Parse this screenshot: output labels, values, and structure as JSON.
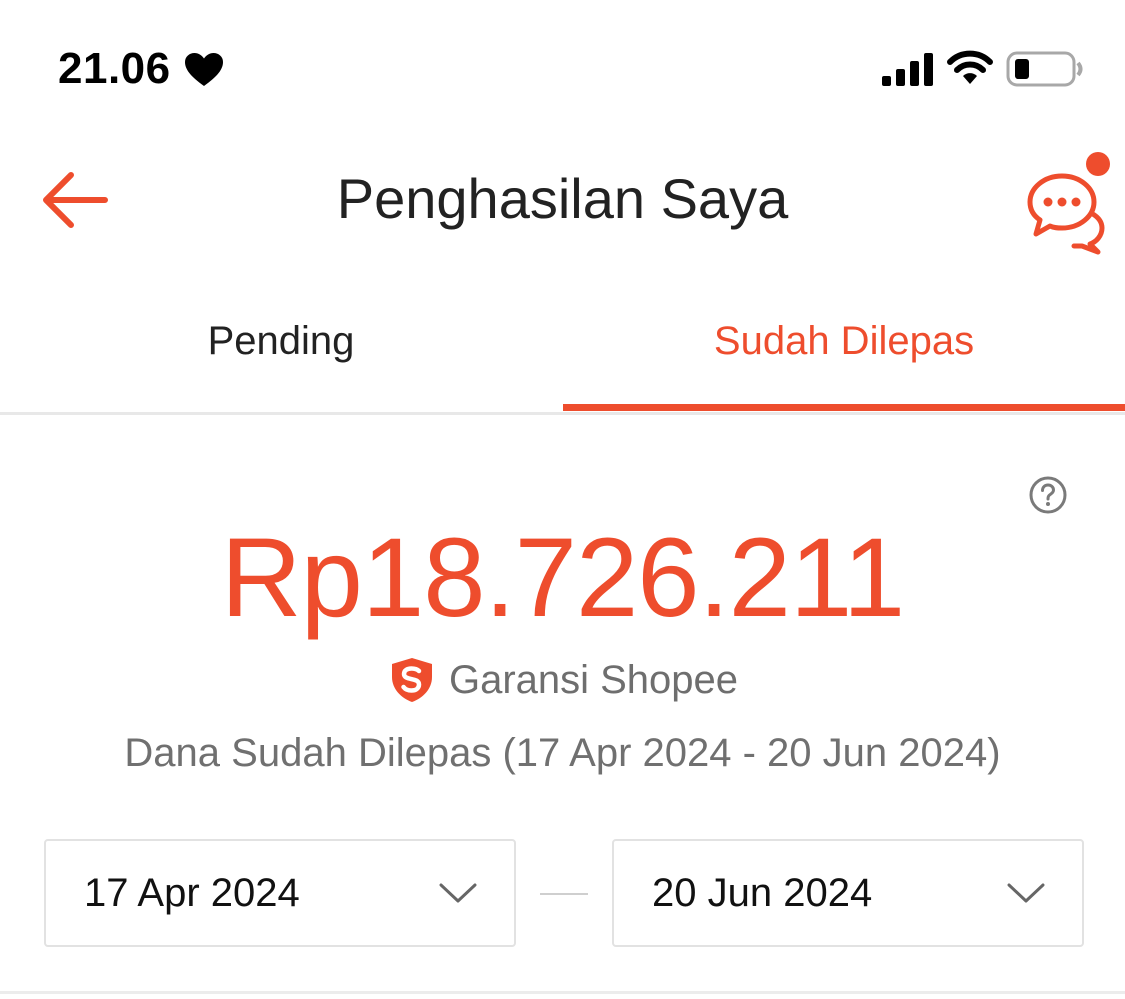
{
  "status_bar": {
    "time": "21.06",
    "icons": [
      "heart-icon",
      "signal-icon",
      "wifi-icon",
      "battery-icon"
    ]
  },
  "header": {
    "title": "Penghasilan Saya",
    "back_icon": "arrow-left-icon",
    "chat_icon": "chat-icon",
    "has_notification_dot": true
  },
  "tabs": [
    {
      "label": "Pending",
      "active": false
    },
    {
      "label": "Sudah Dilepas",
      "active": true
    }
  ],
  "summary": {
    "amount": "Rp18.726.211",
    "guarantee_label": "Garansi Shopee",
    "range_text": "Dana Sudah Dilepas (17 Apr 2024 - 20 Jun 2024)",
    "help_icon": "help-icon"
  },
  "date_filter": {
    "start": "17 Apr 2024",
    "end": "20 Jun 2024"
  },
  "colors": {
    "accent": "#ee4d2d",
    "text_primary": "#222222",
    "text_secondary": "#707070"
  }
}
